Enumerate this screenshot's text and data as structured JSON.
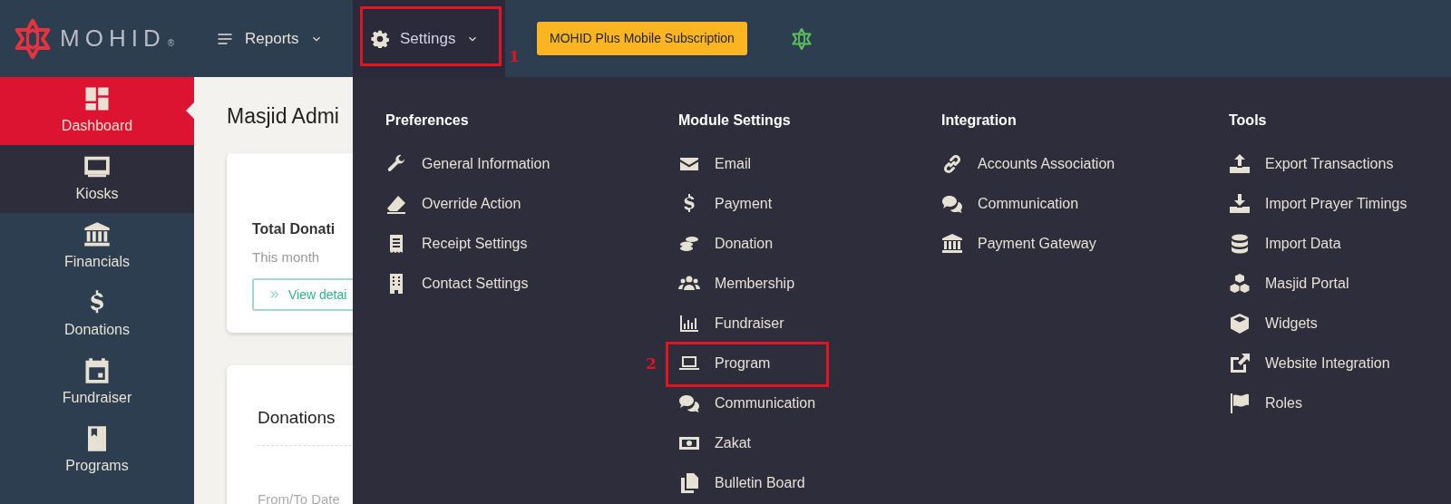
{
  "top_bar": {
    "logo": "MOHID",
    "logo_mark": "®",
    "nav": [
      {
        "label": "Reports",
        "selected": false
      },
      {
        "label": "Settings",
        "selected": true,
        "callout": "1"
      }
    ],
    "subscription_button": "MOHID Plus Mobile Subscription"
  },
  "sidebar": {
    "items": [
      {
        "label": "Dashboard",
        "selected": true,
        "highlighted": false
      },
      {
        "label": "Kiosks",
        "selected": false,
        "highlighted": true
      },
      {
        "label": "Financials",
        "selected": false,
        "highlighted": false
      },
      {
        "label": "Donations",
        "selected": false,
        "highlighted": false
      },
      {
        "label": "Fundraiser",
        "selected": false,
        "highlighted": false
      },
      {
        "label": "Programs",
        "selected": false,
        "highlighted": false
      }
    ]
  },
  "content": {
    "title": "Masjid Admi",
    "summary_card": {
      "title": "Total Donati",
      "subtitle": "This month",
      "button": "View detai"
    },
    "donations_card": {
      "title": "Donations",
      "field_label": "From/To Date"
    }
  },
  "settings_menu": {
    "columns": [
      {
        "heading": "Preferences",
        "items": [
          {
            "label": "General Information"
          },
          {
            "label": "Override Action"
          },
          {
            "label": "Receipt Settings"
          },
          {
            "label": "Contact Settings"
          }
        ]
      },
      {
        "heading": "Module Settings",
        "items": [
          {
            "label": "Email"
          },
          {
            "label": "Payment"
          },
          {
            "label": "Donation"
          },
          {
            "label": "Membership"
          },
          {
            "label": "Fundraiser"
          },
          {
            "label": "Program",
            "callout": "2"
          },
          {
            "label": "Communication"
          },
          {
            "label": "Zakat"
          },
          {
            "label": "Bulletin Board"
          }
        ]
      },
      {
        "heading": "Integration",
        "items": [
          {
            "label": "Accounts Association"
          },
          {
            "label": "Communication"
          },
          {
            "label": "Payment Gateway"
          }
        ]
      },
      {
        "heading": "Tools",
        "items": [
          {
            "label": "Export Transactions"
          },
          {
            "label": "Import Prayer Timings"
          },
          {
            "label": "Import Data"
          },
          {
            "label": "Masjid Portal"
          },
          {
            "label": "Widgets"
          },
          {
            "label": "Website Integration"
          },
          {
            "label": "Roles"
          }
        ]
      }
    ]
  }
}
